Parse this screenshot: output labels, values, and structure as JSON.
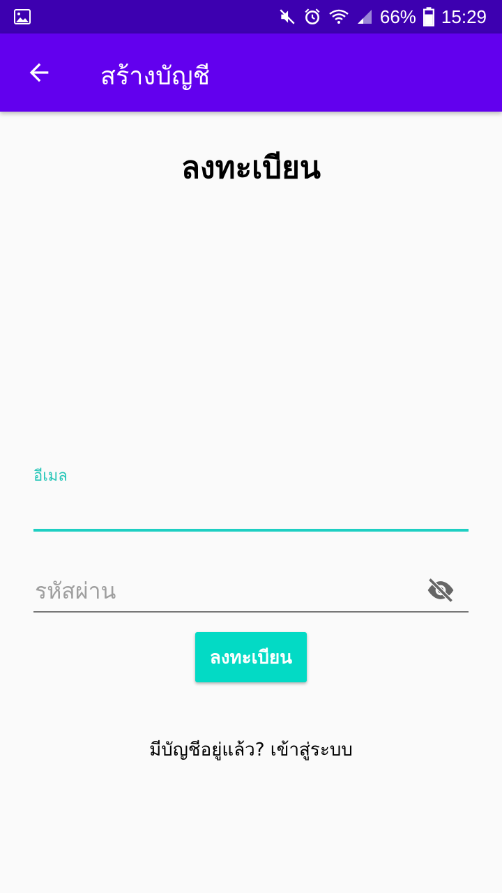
{
  "status_bar": {
    "battery_percent": "66%",
    "time": "15:29",
    "icons": [
      "gallery-icon",
      "mute-icon",
      "alarm-icon",
      "wifi-icon",
      "signal-icon",
      "battery-icon"
    ]
  },
  "app_bar": {
    "title": "สร้างบัญชี",
    "back_icon": "arrow-back-icon"
  },
  "page": {
    "heading": "ลงทะเบียน"
  },
  "form": {
    "email_label": "อีเมล",
    "email_value": "",
    "password_placeholder": "รหัสผ่าน",
    "password_value": "",
    "password_toggle_icon": "eye-off-icon",
    "register_button": "ลงทะเบียน"
  },
  "footer": {
    "login_link": "มีบัญชีอยู่แล้ว? เข้าสู่ระบบ"
  },
  "colors": {
    "status_bar": "#3d00b0",
    "app_bar": "#6200ee",
    "accent": "#03dac5",
    "background": "#fafafa"
  }
}
